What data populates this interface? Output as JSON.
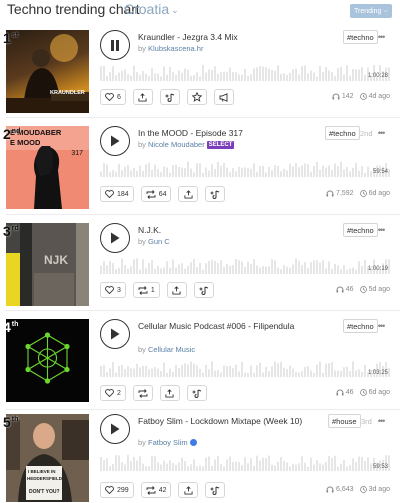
{
  "header": {
    "title": "Techno trending chart",
    "region": "Croatia",
    "trending_label": "Trending"
  },
  "tracks": [
    {
      "rank": "1",
      "rank_suffix": "st",
      "title": "Kraundler - Jezgra 3.4 Mix",
      "by": "by",
      "artist": "Klubskascena.hr",
      "tag": "#techno",
      "prev_rank": "",
      "duration": "1:00:28",
      "likes": "6",
      "reposts": "",
      "plays": "142",
      "age": "4d ago",
      "playing": true,
      "art_text": "KRAUNDLER"
    },
    {
      "rank": "2",
      "rank_suffix": "nd",
      "title": "In the MOOD - Episode 317",
      "by": "by",
      "artist": "Nicole Moudaber",
      "badge": "SELECT",
      "tag": "#techno",
      "prev_rank": "2nd",
      "duration": "59:54",
      "likes": "184",
      "reposts": "64",
      "plays": "7,592",
      "age": "6d ago",
      "playing": false,
      "art_text_1": "E MOUDABER",
      "art_text_2": "E MOOD",
      "art_text_3": "317"
    },
    {
      "rank": "3",
      "rank_suffix": "rd",
      "title": "N.J.K.",
      "by": "by",
      "artist": "Gun C",
      "tag": "#techno",
      "prev_rank": "",
      "duration": "1:00:19",
      "likes": "3",
      "reposts": "1",
      "plays": "46",
      "age": "5d ago",
      "playing": false,
      "art_text": "NJK"
    },
    {
      "rank": "4",
      "rank_suffix": "th",
      "title": "Cellular Music Podcast #006 - Filipendula",
      "by": "by",
      "artist": "Cellular Music",
      "tag": "#techno",
      "prev_rank": "",
      "duration": "1:03:25",
      "likes": "2",
      "reposts": "",
      "plays": "46",
      "age": "6d ago",
      "playing": false
    },
    {
      "rank": "5",
      "rank_suffix": "th",
      "title": "Fatboy Slim - Lockdown Mixtape (Week 10)",
      "by": "by",
      "artist": "Fatboy Slim",
      "tag": "#house",
      "prev_rank": "3rd",
      "duration": "59:53",
      "likes": "299",
      "reposts": "42",
      "plays": "6,643",
      "age": "3d ago",
      "playing": false,
      "art_text_1": "I BELIEVE IN",
      "art_text_2": "HEDDERSFIELD",
      "art_text_3": "DON'T YOU?"
    }
  ],
  "colors": {
    "accent": "#5a7fa6",
    "trending_bg": "#a9c3dc",
    "select_badge": "#7a3fb8",
    "waveform": "#e6e6e6"
  }
}
